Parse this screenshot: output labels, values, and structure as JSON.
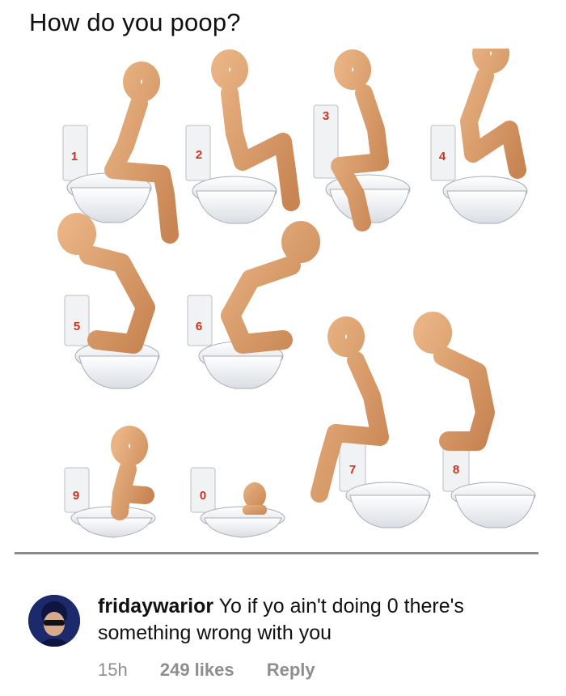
{
  "post": {
    "title": "How do you poop?"
  },
  "illustration": {
    "positions": [
      "1",
      "2",
      "3",
      "4",
      "5",
      "6",
      "7",
      "8",
      "9",
      "0"
    ]
  },
  "comment": {
    "username": "fridaywarior",
    "text": "Yo if yo ain't doing 0 there's something wrong with you",
    "time": "15h",
    "likes": "249 likes",
    "reply_label": "Reply"
  },
  "icons": {
    "avatar": "avatar-icon"
  }
}
